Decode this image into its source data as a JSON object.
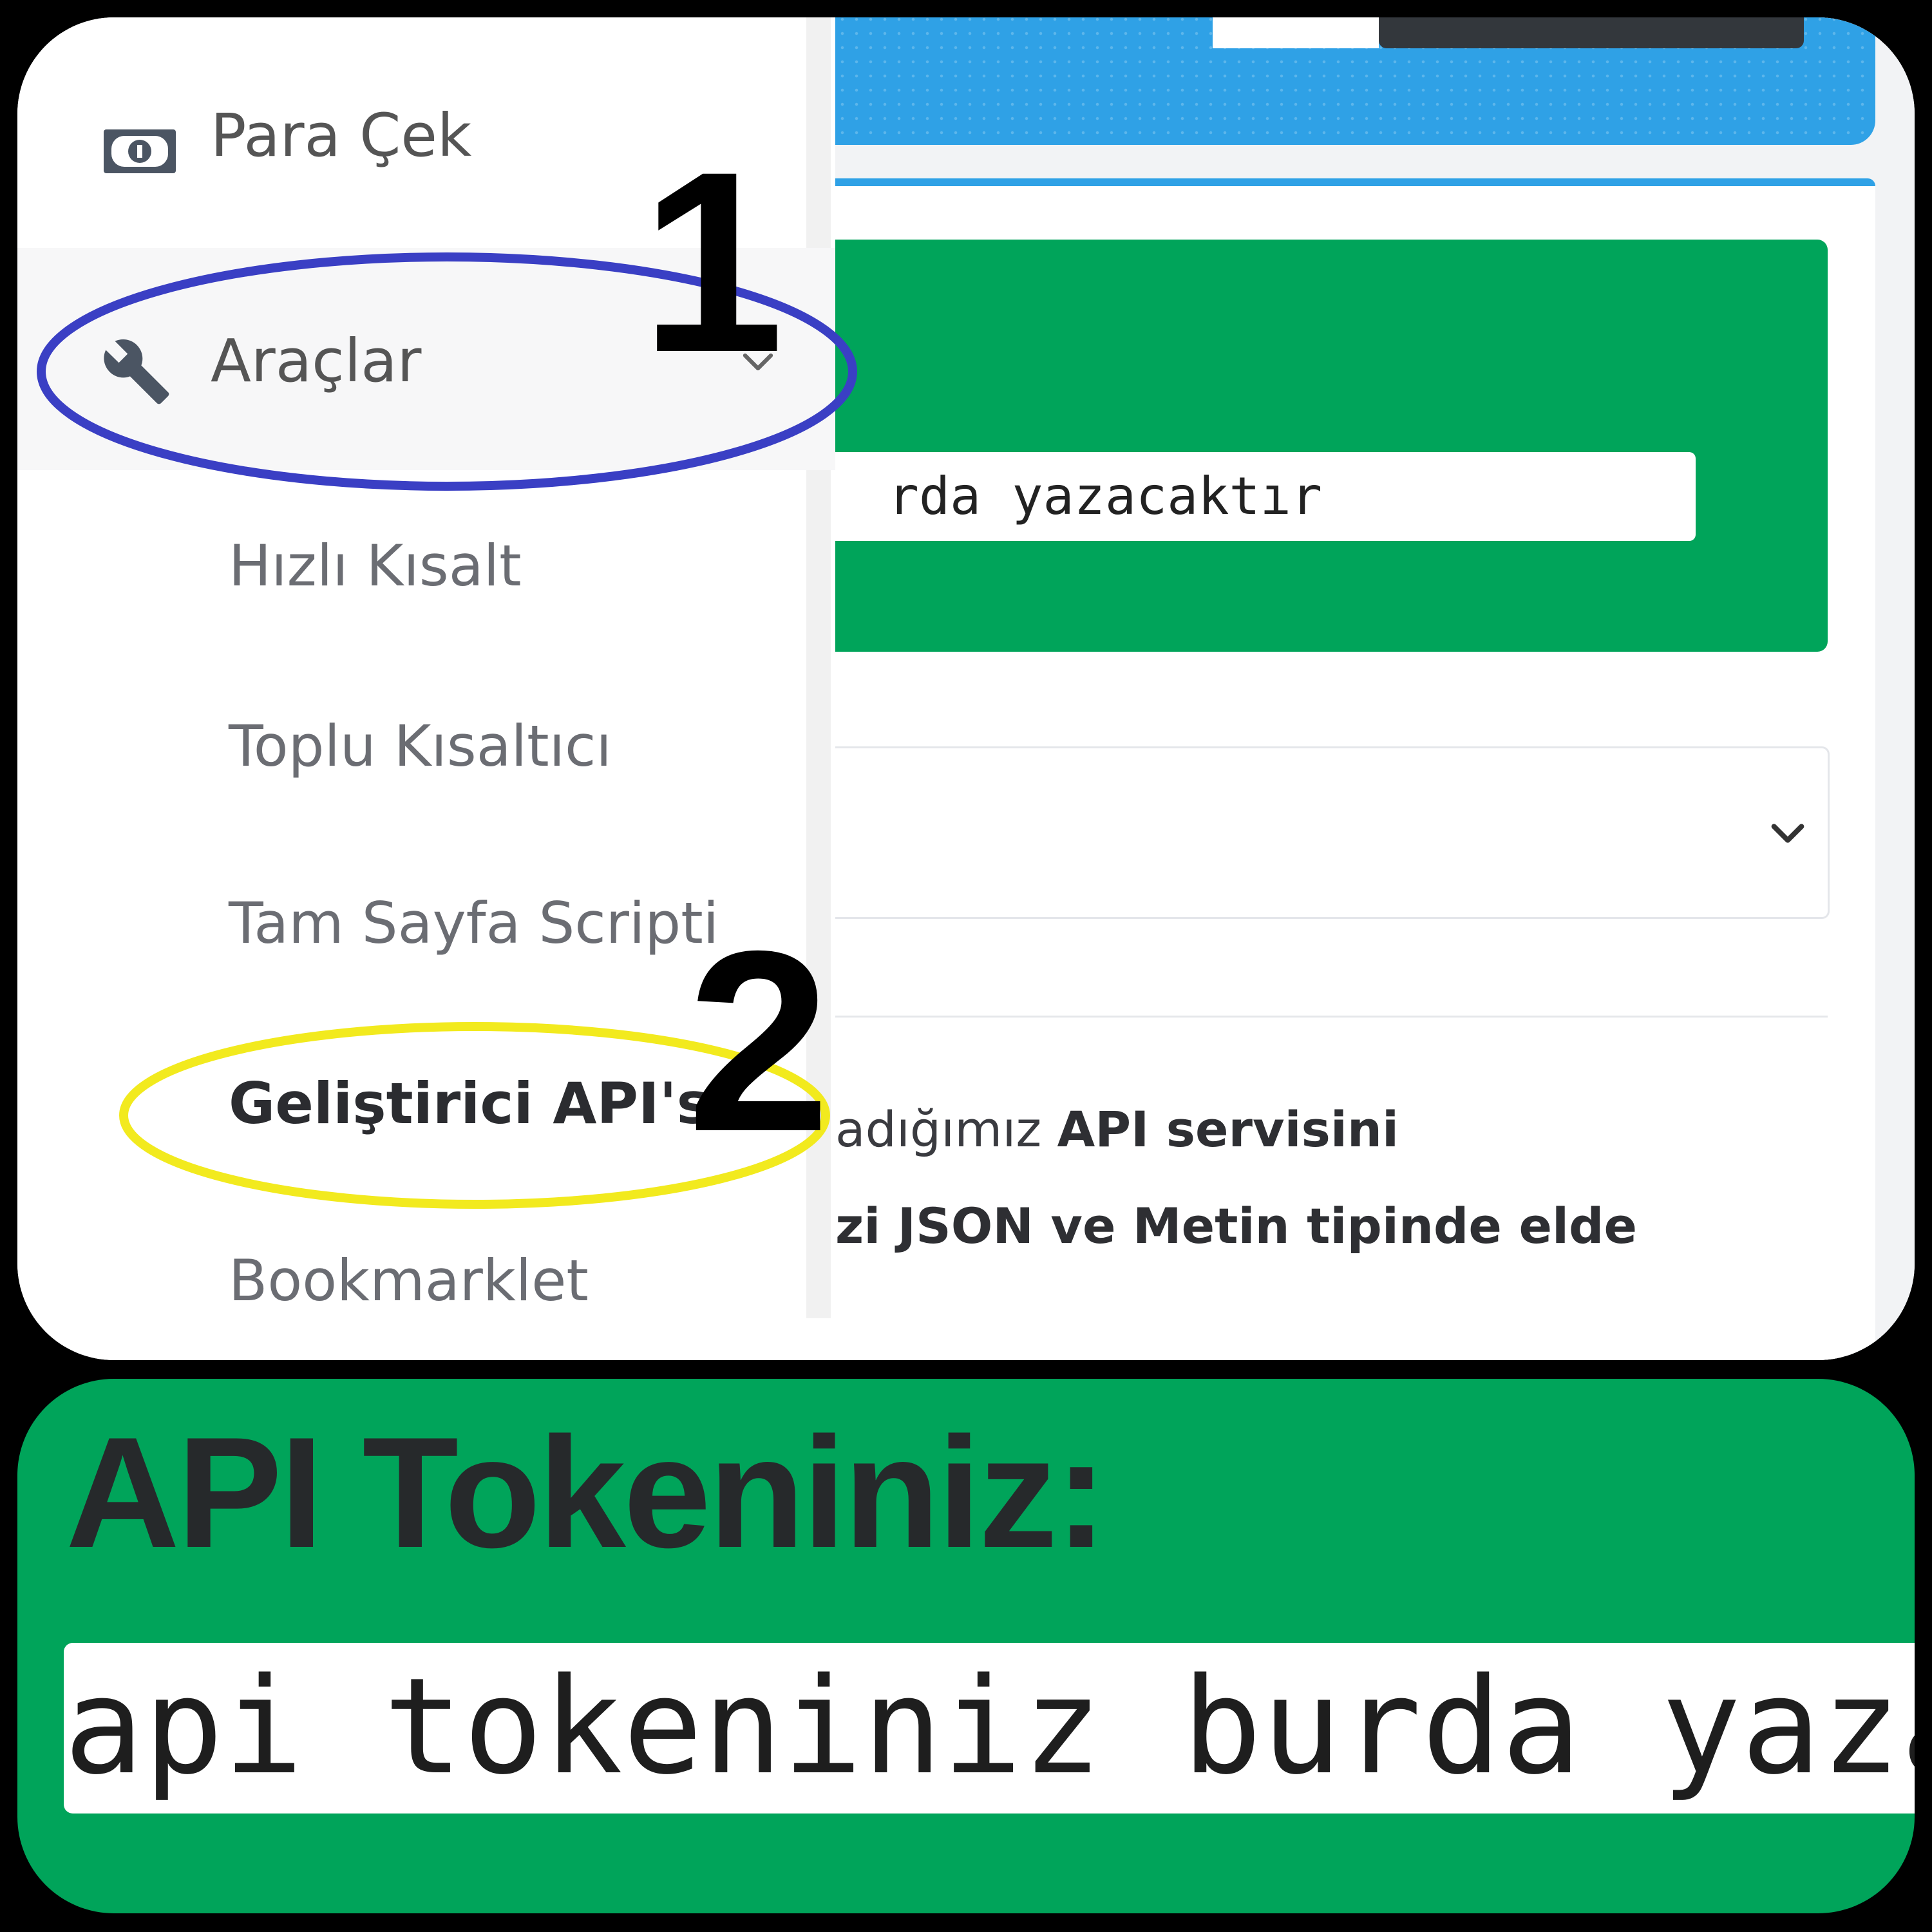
{
  "sidebar": {
    "items": [
      {
        "label": "Para Çek",
        "icon": "money-bill-icon"
      },
      {
        "label": "Araçlar",
        "icon": "wrench-icon"
      }
    ],
    "submenu": [
      {
        "label": "Hızlı Kısalt"
      },
      {
        "label": "Toplu Kısaltıcı"
      },
      {
        "label": "Tam Sayfa Scripti"
      },
      {
        "label": "Geliştirici API'si"
      },
      {
        "label": "Bookmarklet"
      }
    ]
  },
  "annotations": {
    "step1": "1",
    "step2": "2",
    "circle1_color": "#3a3fc4",
    "circle2_color": "#f2ea1e"
  },
  "content": {
    "token_partial": "rda yazacaktır",
    "desc_line1_prefix": "adığımız ",
    "desc_line1_bold": "API servisini",
    "desc_line2": "zi JSON ve Metin tipinde elde"
  },
  "zoom": {
    "heading": "API Tokeniniz:",
    "token_value": "api tokeniniz burda yazacaktı"
  },
  "colors": {
    "green": "#00a45a",
    "blue": "#2fa1e6",
    "dark_button": "#33373c"
  }
}
